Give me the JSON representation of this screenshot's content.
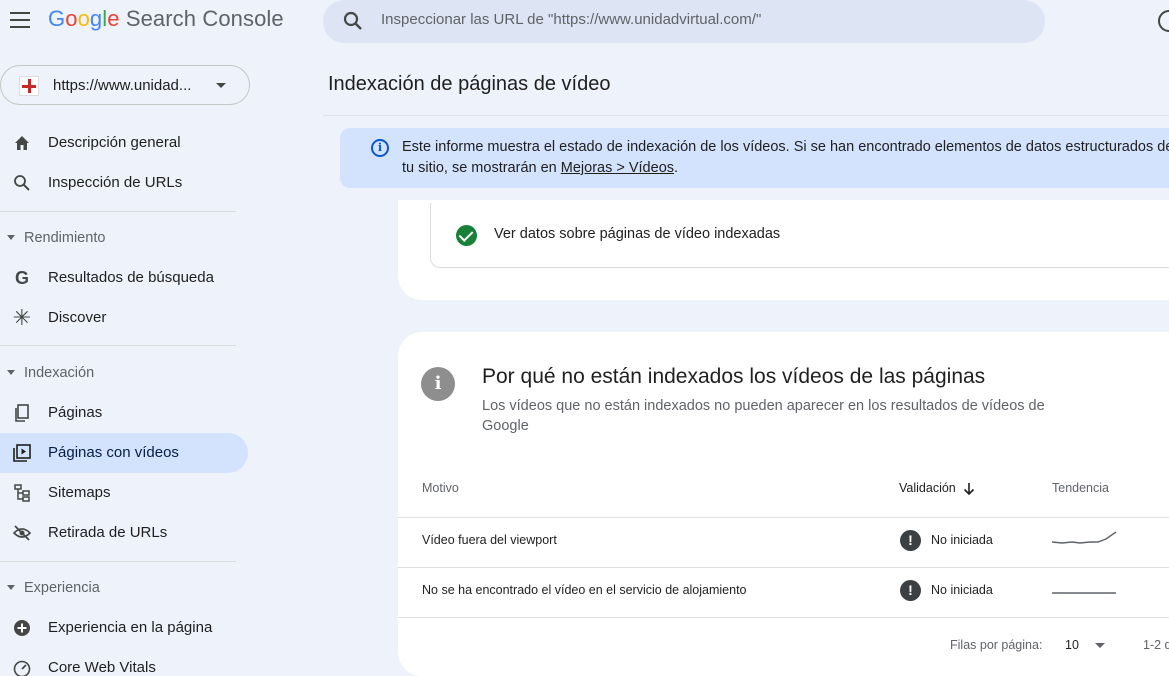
{
  "header": {
    "logo_google": "Google",
    "logo_product": "Search Console",
    "search_placeholder": "Inspeccionar las URL de \"https://www.unidadvirtual.com/\""
  },
  "property": {
    "label": "https://www.unidad..."
  },
  "sidebar": {
    "items": [
      {
        "label": "Descripción general",
        "icon": "home-icon"
      },
      {
        "label": "Inspección de URLs",
        "icon": "search-icon"
      }
    ],
    "sections": [
      {
        "title": "Rendimiento",
        "items": [
          {
            "label": "Resultados de búsqueda",
            "icon": "google-g-icon"
          },
          {
            "label": "Discover",
            "icon": "asterisk-icon"
          }
        ]
      },
      {
        "title": "Indexación",
        "items": [
          {
            "label": "Páginas",
            "icon": "pages-icon"
          },
          {
            "label": "Páginas con vídeos",
            "icon": "video-pages-icon",
            "active": true
          },
          {
            "label": "Sitemaps",
            "icon": "sitemap-icon"
          },
          {
            "label": "Retirada de URLs",
            "icon": "eye-off-icon"
          }
        ]
      },
      {
        "title": "Experiencia",
        "items": [
          {
            "label": "Experiencia en la página",
            "icon": "plus-circle-icon"
          },
          {
            "label": "Core Web Vitals",
            "icon": "gauge-icon"
          }
        ]
      }
    ]
  },
  "main": {
    "title": "Indexación de páginas de vídeo",
    "info_text": "Este informe muestra el estado de indexación de los vídeos. Si se han encontrado elementos de datos estructurados de",
    "info_text_2": "tu sitio, se mostrarán en ",
    "info_link": "Mejoras > Vídeos",
    "info_period": ".",
    "indexed_link": "Ver datos sobre páginas de vídeo indexadas",
    "not_indexed": {
      "title": "Por qué no están indexados los vídeos de las páginas",
      "subtitle": "Los vídeos que no están indexados no pueden aparecer en los resultados de vídeos de Google",
      "columns": {
        "motivo": "Motivo",
        "validacion": "Validación",
        "tendencia": "Tendencia"
      },
      "rows": [
        {
          "motivo": "Vídeo fuera del viewport",
          "validacion": "No iniciada"
        },
        {
          "motivo": "No se ha encontrado el vídeo en el servicio de alojamiento",
          "validacion": "No iniciada"
        }
      ],
      "pager": {
        "rows_label": "Filas por página:",
        "rows_value": "10",
        "range": "1-2 d"
      }
    }
  },
  "colors": {
    "background": "#eef2fa",
    "active_nav": "#d3e3fd",
    "banner": "#d3e3fd",
    "success": "#188038"
  }
}
